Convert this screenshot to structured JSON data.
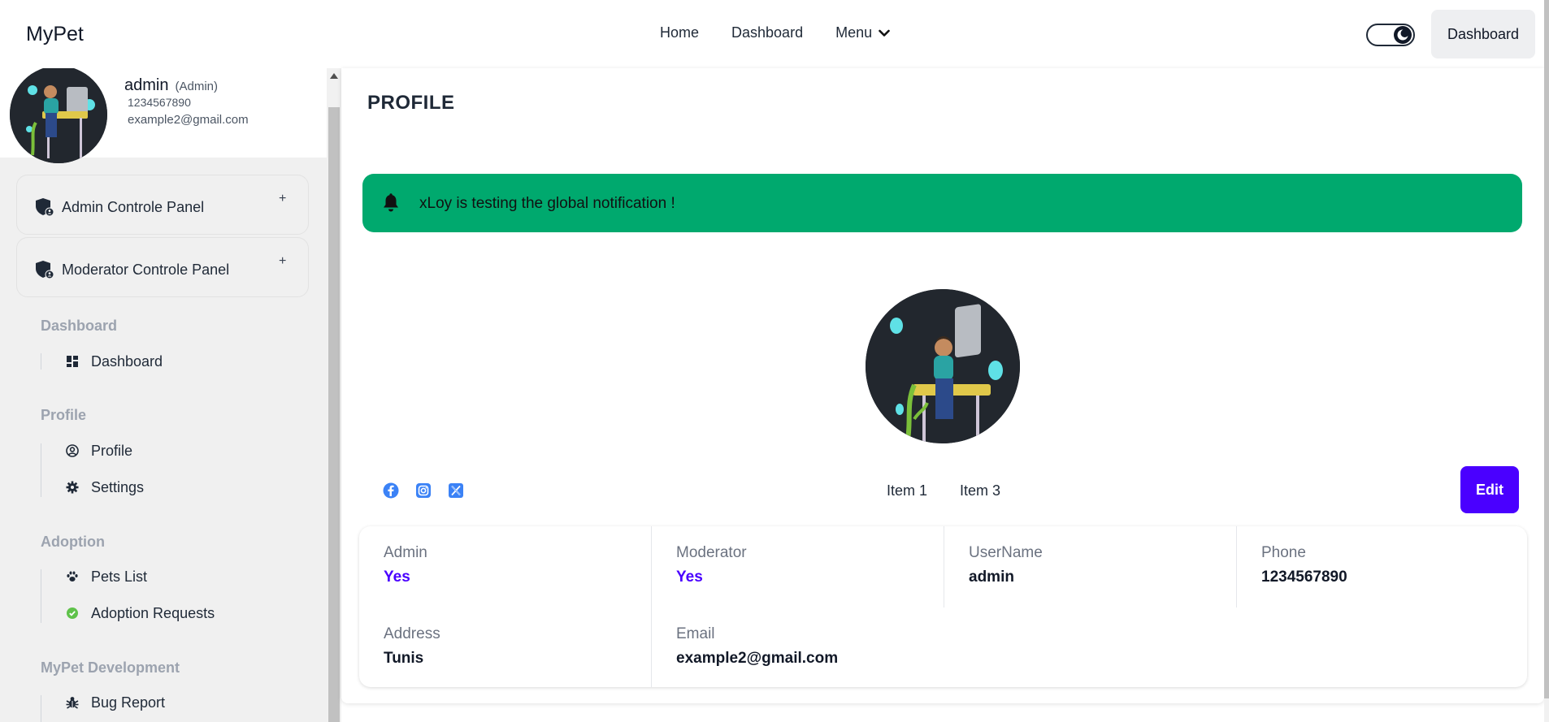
{
  "app": {
    "brand": "MyPet"
  },
  "nav": {
    "links": [
      "Home",
      "Dashboard"
    ],
    "menu_label": "Menu",
    "dashboard_button": "Dashboard"
  },
  "sidebar": {
    "user": {
      "name": "admin",
      "role": "(Admin)",
      "phone": "1234567890",
      "email": "example2@gmail.com"
    },
    "panels": [
      {
        "label": "Admin Controle Panel",
        "toggle": "+"
      },
      {
        "label": "Moderator Controle Panel",
        "toggle": "+"
      }
    ],
    "sections": [
      {
        "title": "Dashboard",
        "items": [
          {
            "label": "Dashboard",
            "icon": "dashboard-icon"
          }
        ]
      },
      {
        "title": "Profile",
        "items": [
          {
            "label": "Profile",
            "icon": "user-circle-icon"
          },
          {
            "label": "Settings",
            "icon": "gear-icon"
          }
        ]
      },
      {
        "title": "Adoption",
        "items": [
          {
            "label": "Pets List",
            "icon": "paw-icon"
          },
          {
            "label": "Adoption Requests",
            "icon": "check-circle-icon"
          }
        ]
      },
      {
        "title": "MyPet Development",
        "items": [
          {
            "label": "Bug Report",
            "icon": "bug-icon"
          }
        ]
      }
    ]
  },
  "main": {
    "title": "PROFILE",
    "notification": "xLoy is testing the global notification !",
    "socials": [
      "facebook-icon",
      "instagram-icon",
      "x-twitter-icon"
    ],
    "tabs": [
      "Item 1",
      "Item 3"
    ],
    "edit_button": "Edit",
    "info": {
      "admin": {
        "label": "Admin",
        "value": "Yes"
      },
      "moderator": {
        "label": "Moderator",
        "value": "Yes"
      },
      "username": {
        "label": "UserName",
        "value": "admin"
      },
      "phone": {
        "label": "Phone",
        "value": "1234567890"
      },
      "address": {
        "label": "Address",
        "value": "Tunis"
      },
      "email": {
        "label": "Email",
        "value": "example2@gmail.com"
      }
    }
  },
  "colors": {
    "accent": "#4a00ff",
    "notification": "#00a96e",
    "sidebar_bg": "#f0f0f0"
  }
}
